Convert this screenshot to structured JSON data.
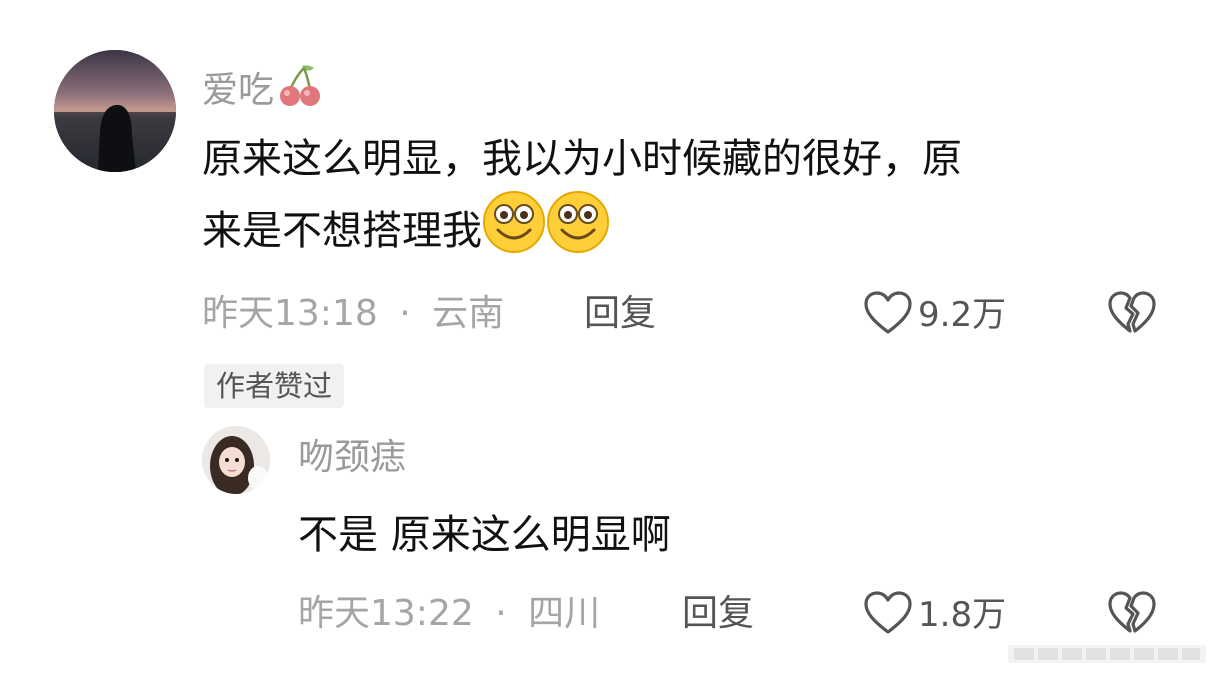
{
  "comment": {
    "username": "爱吃",
    "username_badge_icon": "cherry-icon",
    "text_line1": "原来这么明显，我以为小时候藏的很好，原",
    "text_line2": "来是不想搭理我",
    "text_emojis": [
      "grinning-face-emoji",
      "grinning-face-emoji"
    ],
    "time": "昨天13:18",
    "separator": "·",
    "location": "云南",
    "reply_label": "回复",
    "like_count": "9.2万",
    "author_liked_badge": "作者赞过"
  },
  "reply": {
    "username": "吻颈痣",
    "text": "不是 原来这么明显啊",
    "time": "昨天13:22",
    "separator": "·",
    "location": "四川",
    "reply_label": "回复",
    "like_count": "1.8万"
  },
  "colors": {
    "meta_gray": "#a5a5a5",
    "icon_gray": "#555555",
    "text": "#111111"
  }
}
